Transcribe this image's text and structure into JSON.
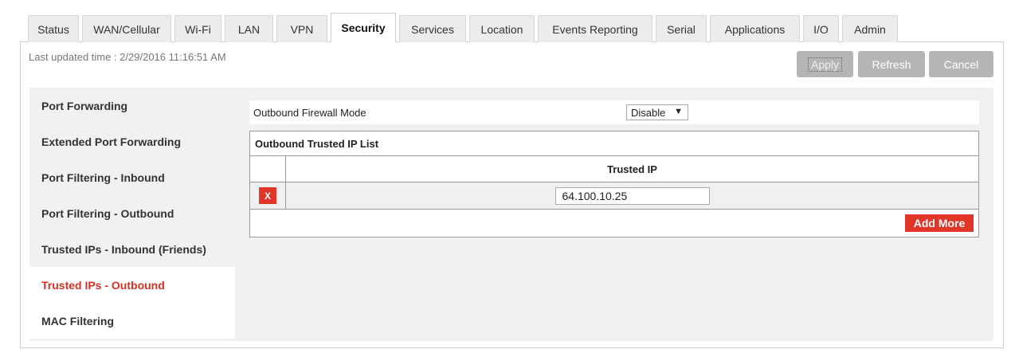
{
  "tabs": [
    {
      "label": "Status",
      "active": false
    },
    {
      "label": "WAN/Cellular",
      "active": false
    },
    {
      "label": "Wi-Fi",
      "active": false
    },
    {
      "label": "LAN",
      "active": false
    },
    {
      "label": "VPN",
      "active": false
    },
    {
      "label": "Security",
      "active": true
    },
    {
      "label": "Services",
      "active": false
    },
    {
      "label": "Location",
      "active": false
    },
    {
      "label": "Events Reporting",
      "active": false
    },
    {
      "label": "Serial",
      "active": false
    },
    {
      "label": "Applications",
      "active": false
    },
    {
      "label": "I/O",
      "active": false
    },
    {
      "label": "Admin",
      "active": false
    }
  ],
  "header": {
    "last_updated": "Last updated time : 2/29/2016 11:16:51 AM",
    "apply_label": "Apply",
    "refresh_label": "Refresh",
    "cancel_label": "Cancel"
  },
  "sidebar": {
    "items": [
      {
        "label": "Port Forwarding"
      },
      {
        "label": "Extended Port Forwarding"
      },
      {
        "label": "Port Filtering - Inbound"
      },
      {
        "label": "Port Filtering - Outbound"
      },
      {
        "label": "Trusted IPs - Inbound (Friends)"
      },
      {
        "label": "Trusted IPs - Outbound"
      },
      {
        "label": "MAC Filtering"
      }
    ],
    "active_index": 5
  },
  "main": {
    "mode_label": "Outbound Firewall Mode",
    "mode_value": "Disable",
    "table_title": "Outbound Trusted IP List",
    "column_header": "Trusted IP",
    "rows": [
      {
        "delete_label": "X",
        "ip": "64.100.10.25"
      }
    ],
    "add_more_label": "Add More"
  },
  "colors": {
    "accent_red": "#e1352a",
    "active_sidebar_text": "#d93025",
    "disabled_button": "#b5b5b5"
  }
}
